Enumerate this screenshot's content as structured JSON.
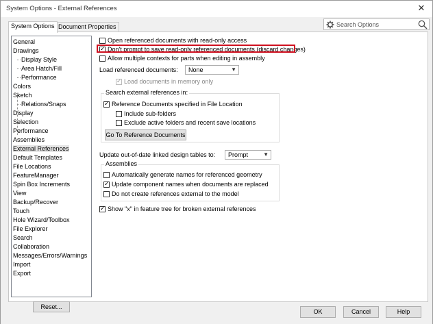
{
  "window": {
    "title": "System Options - External References",
    "close_glyph": "✕"
  },
  "tabs": [
    {
      "label": "System Options",
      "active": true
    },
    {
      "label": "Document Properties",
      "active": false
    }
  ],
  "search": {
    "placeholder": "Search Options"
  },
  "tree": {
    "items": [
      {
        "label": "General"
      },
      {
        "label": "Drawings"
      },
      {
        "label": "Display Style",
        "child": true
      },
      {
        "label": "Area Hatch/Fill",
        "child": true
      },
      {
        "label": "Performance",
        "child": true
      },
      {
        "label": "Colors"
      },
      {
        "label": "Sketch"
      },
      {
        "label": "Relations/Snaps",
        "child": true
      },
      {
        "label": "Display"
      },
      {
        "label": "Selection"
      },
      {
        "label": "Performance"
      },
      {
        "label": "Assemblies"
      },
      {
        "label": "External References",
        "selected": true
      },
      {
        "label": "Default Templates"
      },
      {
        "label": "File Locations"
      },
      {
        "label": "FeatureManager"
      },
      {
        "label": "Spin Box Increments"
      },
      {
        "label": "View"
      },
      {
        "label": "Backup/Recover"
      },
      {
        "label": "Touch"
      },
      {
        "label": "Hole Wizard/Toolbox"
      },
      {
        "label": "File Explorer"
      },
      {
        "label": "Search"
      },
      {
        "label": "Collaboration"
      },
      {
        "label": "Messages/Errors/Warnings"
      },
      {
        "label": "Import"
      },
      {
        "label": "Export"
      }
    ],
    "reset_label": "Reset..."
  },
  "options": {
    "open_readonly": {
      "label": "Open referenced documents with read-only access",
      "checked": false
    },
    "dont_prompt": {
      "label": "Don't prompt to save read-only referenced documents (discard changes)",
      "checked": true
    },
    "multiple_contexts": {
      "label": "Allow multiple contexts for parts when editing in assembly",
      "checked": false
    },
    "load_ref_docs_label": "Load referenced documents:",
    "load_ref_docs_value": "None",
    "load_in_memory": {
      "label": "Load documents in memory only",
      "checked": true
    },
    "search_group_title": "Search external references in:",
    "ref_docs_specified": {
      "label": "Reference Documents specified in File Location",
      "checked": true
    },
    "include_subfolders": {
      "label": "Include sub-folders",
      "checked": false
    },
    "exclude_active": {
      "label": "Exclude active folders and recent save locations",
      "checked": false
    },
    "goto_ref_docs": "Go To Reference Documents",
    "update_tables_label": "Update out-of-date linked design tables to:",
    "update_tables_value": "Prompt",
    "assemblies_group_title": "Assemblies",
    "auto_generate": {
      "label": "Automatically generate names for referenced geometry",
      "checked": false
    },
    "update_component_names": {
      "label": "Update component names when documents are replaced",
      "checked": true
    },
    "no_create_refs": {
      "label": "Do not create references external to the model",
      "checked": false
    },
    "show_x": {
      "label": "Show \"x\" in feature tree for broken external references",
      "checked": true
    }
  },
  "footer": {
    "ok": "OK",
    "cancel": "Cancel",
    "help": "Help"
  },
  "colors": {
    "highlight": "#d01020"
  }
}
